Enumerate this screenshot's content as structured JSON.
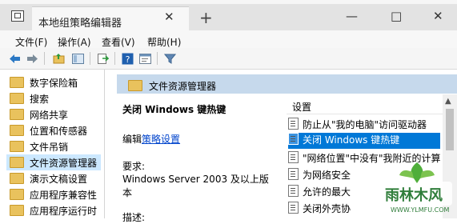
{
  "window": {
    "tab_title": "本地组策略编辑器",
    "controls": {
      "minimize": "—",
      "maximize": "□",
      "close": "✕",
      "tab_close": "✕",
      "new_tab": "+"
    }
  },
  "menu": [
    {
      "label": "文件(F)"
    },
    {
      "label": "操作(A)"
    },
    {
      "label": "查看(V)"
    },
    {
      "label": "帮助(H)"
    }
  ],
  "toolbar": {
    "icons": [
      "back-arrow-icon",
      "forward-arrow-icon",
      "up-folder-icon",
      "show-hide-tree-icon",
      "export-list-icon",
      "help-icon",
      "properties-icon",
      "filter-icon"
    ]
  },
  "tree": {
    "items": [
      {
        "label": "数字保险箱"
      },
      {
        "label": "搜索"
      },
      {
        "label": "网络共享"
      },
      {
        "label": "位置和传感器"
      },
      {
        "label": "文件吊销"
      },
      {
        "label": "文件资源管理器",
        "selected": true
      },
      {
        "label": "演示文稿设置"
      },
      {
        "label": "应用程序兼容性"
      },
      {
        "label": "应用程序运行时"
      }
    ]
  },
  "content": {
    "header": "文件资源管理器",
    "description": {
      "title": "关闭 Windows 键热键",
      "edit_prefix": "编辑",
      "edit_link": "策略设置",
      "requirements_label": "要求:",
      "requirements_value_line1": "Windows Server 2003 及以上版",
      "requirements_value_line2": "本",
      "more_label": "描述:"
    },
    "settings_column": "设置",
    "settings": [
      {
        "label": "防止从\"我的电脑\"访问驱动器"
      },
      {
        "label": "关闭 Windows 键热键",
        "selected": true
      },
      {
        "label": "\"网络位置\"中没有\"我附近的计算"
      },
      {
        "label": "为网络安全"
      },
      {
        "label": "允许的最大"
      },
      {
        "label": "关闭外壳协"
      }
    ]
  },
  "watermark": {
    "text": "雨林木风",
    "url": "WWW.YLMFU.COM"
  },
  "colors": {
    "selection_blue": "#0078d7",
    "tree_selected": "#cce8ff",
    "header_band": "#c6d9ec",
    "link": "#0044cc",
    "watermark_green": "#2f7d3a"
  }
}
